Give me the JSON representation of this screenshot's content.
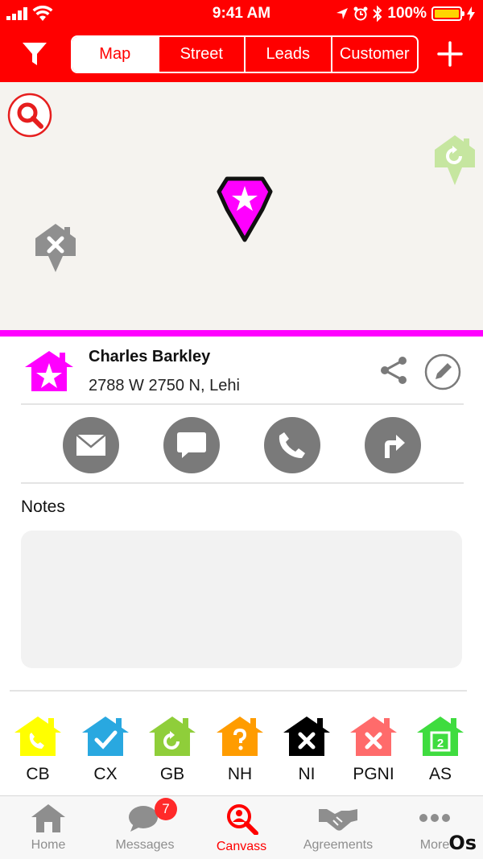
{
  "status_bar": {
    "time": "9:41 AM",
    "battery": "100%"
  },
  "header": {
    "tabs": [
      {
        "label": "Map",
        "active": true
      },
      {
        "label": "Street",
        "active": false
      },
      {
        "label": "Leads",
        "active": false
      },
      {
        "label": "Customer",
        "active": false
      }
    ],
    "filter_icon": "filter-icon",
    "add_icon": "plus-icon",
    "accent_color": "#ff0000"
  },
  "map": {
    "search_icon": "search-icon",
    "pins": [
      {
        "icon": "house-x-pin",
        "color": "#8f8f8f"
      },
      {
        "icon": "star-pin",
        "color": "#ff00ff"
      },
      {
        "icon": "house-refresh-pin",
        "color": "#b9e28a"
      }
    ],
    "divider_color": "#ff00ff"
  },
  "contact": {
    "name": "Charles Barkley",
    "address": "2788 W 2750 N, Lehi",
    "status_color": "#ff00ff"
  },
  "actions": [
    {
      "icon": "envelope-icon"
    },
    {
      "icon": "chat-bubble-icon"
    },
    {
      "icon": "phone-icon"
    },
    {
      "icon": "directions-icon"
    }
  ],
  "notes": {
    "label": "Notes",
    "value": ""
  },
  "statuses": [
    {
      "code": "CB",
      "color": "#ffff00",
      "icon": "phone-icon"
    },
    {
      "code": "CX",
      "color": "#29a8e0",
      "icon": "check-icon"
    },
    {
      "code": "GB",
      "color": "#8fce3a",
      "icon": "refresh-icon"
    },
    {
      "code": "NH",
      "color": "#ff9c00",
      "icon": "question-icon"
    },
    {
      "code": "NI",
      "color": "#000000",
      "icon": "x-icon"
    },
    {
      "code": "PGNI",
      "color": "#ff6b6b",
      "icon": "x-icon"
    },
    {
      "code": "AS",
      "color": "#3fdc3f",
      "icon": "calendar-icon"
    }
  ],
  "tabbar": {
    "items": [
      {
        "label": "Home",
        "icon": "home-icon"
      },
      {
        "label": "Messages",
        "icon": "messages-icon",
        "badge": "7"
      },
      {
        "label": "Canvass",
        "icon": "canvass-icon",
        "active": true
      },
      {
        "label": "Agreements",
        "icon": "handshake-icon"
      },
      {
        "label": "More",
        "icon": "more-icon"
      }
    ]
  },
  "watermark": "Os"
}
